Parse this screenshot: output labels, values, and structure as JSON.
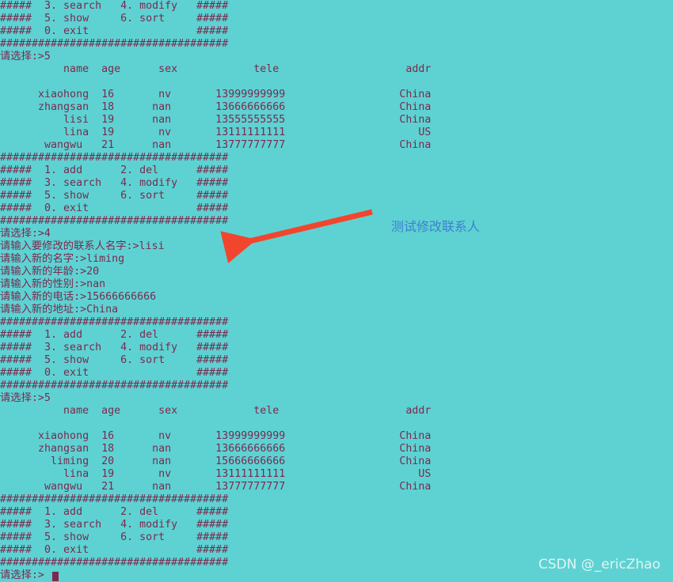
{
  "terminal": {
    "background_color": "#5ed2d2",
    "text_color": "#7a2a4e",
    "annotation_color": "#3f7fd0",
    "arrow_color": "#f2452e",
    "watermark_color": "#e9f7f7",
    "screen_text": "#####  3. search   4. modify   #####\n#####  5. show     6. sort     #####\n#####  0. exit                 #####\n####################################\n请选择:>5\n          name  age      sex            tele                    addr\n\n      xiaohong  16       nv       13999999999                  China\n      zhangsan  18      nan       13666666666                  China\n          lisi  19      nan       13555555555                  China\n          lina  19       nv       13111111111                     US\n       wangwu   21      nan       13777777777                  China\n####################################\n#####  1. add      2. del      #####\n#####  3. search   4. modify   #####\n#####  5. show     6. sort     #####\n#####  0. exit                 #####\n####################################\n请选择:>4\n请输入要修改的联系人名字:>lisi\n请输入新的名字:>liming\n请输入新的年龄:>20\n请输入新的性别:>nan\n请输入新的电话:>15666666666\n请输入新的地址:>China\n####################################\n#####  1. add      2. del      #####\n#####  3. search   4. modify   #####\n#####  5. show     6. sort     #####\n#####  0. exit                 #####\n####################################\n请选择:>5\n          name  age      sex            tele                    addr\n\n      xiaohong  16       nv       13999999999                  China\n      zhangsan  18      nan       13666666666                  China\n        liming  20      nan       15666666666                  China\n          lina  19       nv       13111111111                     US\n       wangwu   21      nan       13777777777                  China\n####################################\n#####  1. add      2. del      #####\n#####  3. search   4. modify   #####\n#####  5. show     6. sort     #####\n#####  0. exit                 #####\n####################################\n请选择:>"
  },
  "menu": {
    "separator": "####################################",
    "border": "#####",
    "items": [
      {
        "key": "1.",
        "label": "add"
      },
      {
        "key": "2.",
        "label": "del"
      },
      {
        "key": "3.",
        "label": "search"
      },
      {
        "key": "4.",
        "label": "modify"
      },
      {
        "key": "5.",
        "label": "show"
      },
      {
        "key": "6.",
        "label": "sort"
      },
      {
        "key": "0.",
        "label": "exit"
      }
    ]
  },
  "prompts": {
    "choose": "请选择:>",
    "choice_show_top": "5",
    "choice_modify": "4",
    "choice_show_bottom": "5",
    "choice_final": "",
    "modify_name_target": "请输入要修改的联系人名字:>",
    "modify_name_target_value": "lisi",
    "new_name": "请输入新的名字:>",
    "new_name_value": "liming",
    "new_age": "请输入新的年龄:>",
    "new_age_value": "20",
    "new_sex": "请输入新的性别:>",
    "new_sex_value": "nan",
    "new_tele": "请输入新的电话:>",
    "new_tele_value": "15666666666",
    "new_addr": "请输入新的地址:>",
    "new_addr_value": "China"
  },
  "table": {
    "headers": [
      "name",
      "age",
      "sex",
      "tele",
      "addr"
    ],
    "before": [
      {
        "name": "xiaohong",
        "age": "16",
        "sex": "nv",
        "tele": "13999999999",
        "addr": "China"
      },
      {
        "name": "zhangsan",
        "age": "18",
        "sex": "nan",
        "tele": "13666666666",
        "addr": "China"
      },
      {
        "name": "lisi",
        "age": "19",
        "sex": "nan",
        "tele": "13555555555",
        "addr": "China"
      },
      {
        "name": "lina",
        "age": "19",
        "sex": "nv",
        "tele": "13111111111",
        "addr": "US"
      },
      {
        "name": "wangwu",
        "age": "21",
        "sex": "nan",
        "tele": "13777777777",
        "addr": "China"
      }
    ],
    "after": [
      {
        "name": "xiaohong",
        "age": "16",
        "sex": "nv",
        "tele": "13999999999",
        "addr": "China"
      },
      {
        "name": "zhangsan",
        "age": "18",
        "sex": "nan",
        "tele": "13666666666",
        "addr": "China"
      },
      {
        "name": "liming",
        "age": "20",
        "sex": "nan",
        "tele": "15666666666",
        "addr": "China"
      },
      {
        "name": "lina",
        "age": "19",
        "sex": "nv",
        "tele": "13111111111",
        "addr": "US"
      },
      {
        "name": "wangwu",
        "age": "21",
        "sex": "nan",
        "tele": "13777777777",
        "addr": "China"
      }
    ]
  },
  "annotation": {
    "text": "测试修改联系人"
  },
  "watermark": {
    "text": "CSDN @_ericZhao"
  }
}
